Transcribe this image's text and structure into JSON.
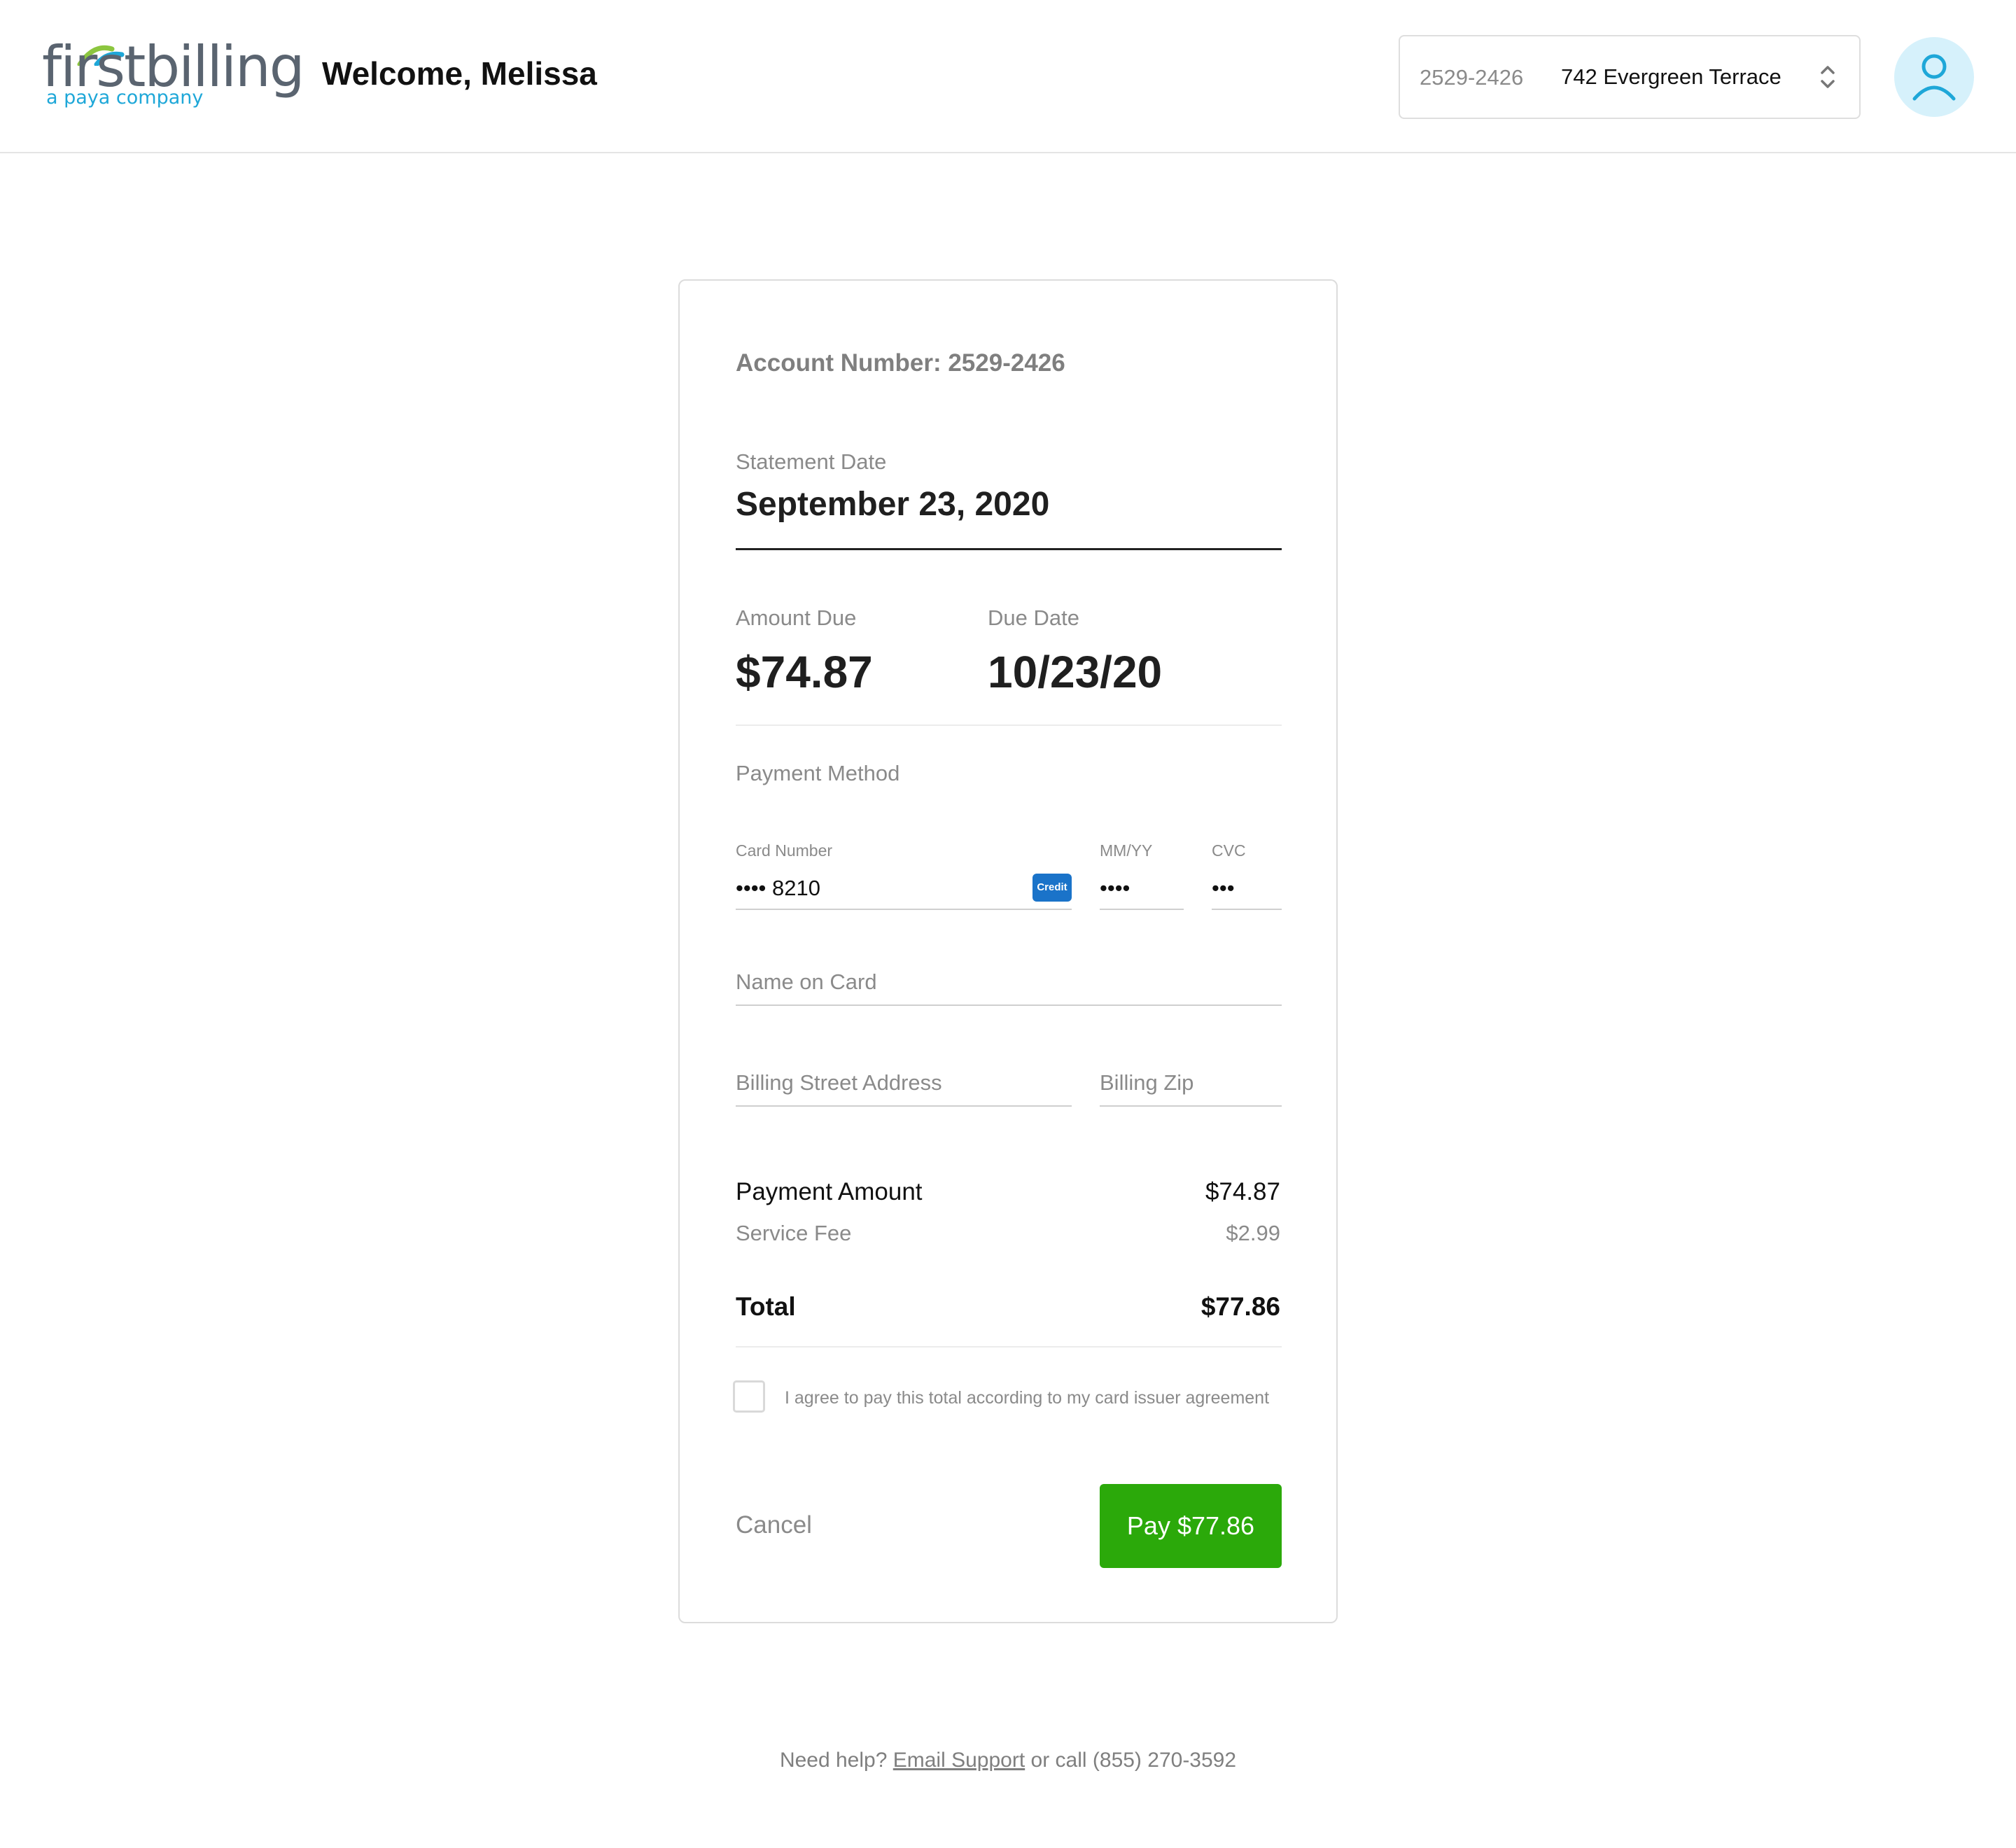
{
  "header": {
    "logo": {
      "main_text": "firstbilling",
      "sub_text": "a paya company",
      "arc_colors": [
        "#8cc63f",
        "#1ea7d8"
      ]
    },
    "welcome": "Welcome, Melissa",
    "account_select": {
      "account_number": "2529-2426",
      "address": "742 Evergreen Terrace",
      "icon": "chevron-up-down-icon"
    },
    "avatar_icon": "user-icon"
  },
  "card": {
    "account_number": "Account Number: 2529-2426",
    "statement": {
      "label": "Statement Date",
      "value": "September 23, 2020"
    },
    "amount_due": {
      "label": "Amount Due",
      "value": "$74.87"
    },
    "due_date": {
      "label": "Due Date",
      "value": "10/23/20"
    },
    "payment_method": {
      "label": "Payment Method",
      "card_number": {
        "label": "Card Number",
        "value": "•••• 8210",
        "badge": "Credit"
      },
      "expiry": {
        "label": "MM/YY",
        "value": "••••"
      },
      "cvc": {
        "label": "CVC",
        "value": "•••"
      },
      "name_on_card": {
        "placeholder": "Name on Card"
      },
      "billing_street": {
        "placeholder": "Billing Street Address"
      },
      "billing_zip": {
        "placeholder": "Billing Zip"
      }
    },
    "summary": {
      "payment_amount_label": "Payment Amount",
      "payment_amount_value": "$74.87",
      "service_fee_label": "Service Fee",
      "service_fee_value": "$2.99",
      "total_label": "Total",
      "total_value": "$77.86"
    },
    "agreement": {
      "text": "I agree to pay this total according to my card issuer agreement",
      "checked": false
    },
    "actions": {
      "cancel": "Cancel",
      "pay": "Pay $77.86"
    }
  },
  "footer": {
    "prefix": "Need help?",
    "link": "Email Support",
    "suffix": "or call (855) 270-3592"
  },
  "colors": {
    "accent_green": "#2ba90a",
    "credit_badge_blue": "#1a73c9",
    "avatar_bg": "#d6f1fb",
    "logo_blue": "#1ea7d8"
  }
}
